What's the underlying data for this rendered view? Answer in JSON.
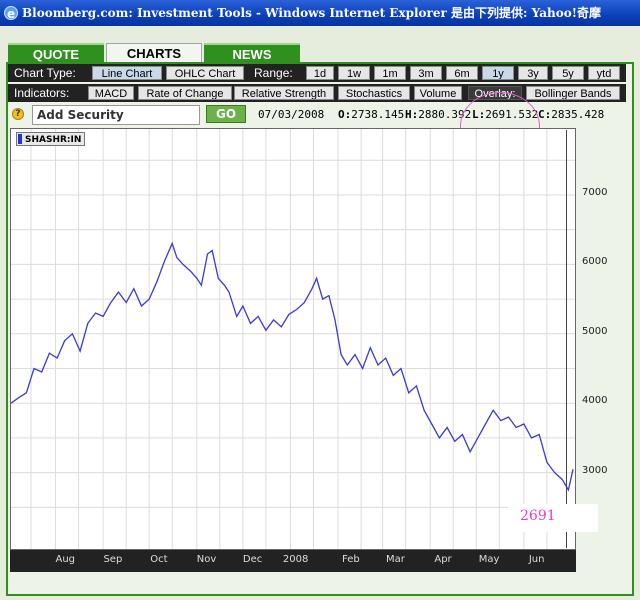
{
  "window": {
    "title": "Bloomberg.com: Investment Tools - Windows Internet Explorer 是由下列提供: Yahoo!奇摩"
  },
  "tabs": [
    {
      "label": "QUOTE"
    },
    {
      "label": "CHARTS"
    },
    {
      "label": "NEWS"
    }
  ],
  "chart_type": {
    "label": "Chart Type:",
    "options": [
      "Line Chart",
      "OHLC Chart"
    ],
    "selected": "Line Chart"
  },
  "range": {
    "label": "Range:",
    "options": [
      "1d",
      "1w",
      "1m",
      "3m",
      "6m",
      "1y",
      "3y",
      "5y",
      "ytd"
    ],
    "selected": "1y"
  },
  "indicators": {
    "label": "Indicators:",
    "options": [
      "MACD",
      "Rate of Change",
      "Relative Strength",
      "Stochastics",
      "Volume"
    ],
    "overlay_label": "Overlay:",
    "overlay_option": "Bollinger Bands"
  },
  "security": {
    "placeholder": "Add Security",
    "go_label": "GO",
    "date": "07/03/2008",
    "open_label": "O:",
    "open": "2738.145",
    "high_label": "H:",
    "high": "2880.392",
    "low_label": "L:",
    "low": "2691.532",
    "close_label": "C:",
    "close": "2835.428"
  },
  "symbol_tag": "SHASHR:IN",
  "annotation": "2691",
  "colors": {
    "line": "#3b3bcc",
    "annotation": "#e040c0",
    "tab_green": "#2f8f1f"
  },
  "chart_data": {
    "type": "line",
    "series_label": "SHASHR:IN",
    "ylim": [
      1900,
      7950
    ],
    "y_ticks": [
      3000,
      4000,
      5000,
      6000,
      7000
    ],
    "x_ticks": [
      "Aug",
      "Sep",
      "Oct",
      "Nov",
      "Dec",
      "2008",
      "Feb",
      "Mar",
      "Apr",
      "May",
      "Jun"
    ],
    "x_range": [
      "2007-07-03",
      "2008-07-03"
    ],
    "points": [
      [
        "2007-07-03",
        4000
      ],
      [
        "2007-07-08",
        4080
      ],
      [
        "2007-07-13",
        4150
      ],
      [
        "2007-07-18",
        4500
      ],
      [
        "2007-07-23",
        4450
      ],
      [
        "2007-07-28",
        4720
      ],
      [
        "2007-08-02",
        4650
      ],
      [
        "2007-08-07",
        4900
      ],
      [
        "2007-08-12",
        5000
      ],
      [
        "2007-08-17",
        4750
      ],
      [
        "2007-08-22",
        5150
      ],
      [
        "2007-08-27",
        5300
      ],
      [
        "2007-09-01",
        5250
      ],
      [
        "2007-09-06",
        5450
      ],
      [
        "2007-09-11",
        5600
      ],
      [
        "2007-09-16",
        5450
      ],
      [
        "2007-09-21",
        5650
      ],
      [
        "2007-09-26",
        5400
      ],
      [
        "2007-10-01",
        5500
      ],
      [
        "2007-10-06",
        5750
      ],
      [
        "2007-10-11",
        6050
      ],
      [
        "2007-10-16",
        6300
      ],
      [
        "2007-10-19",
        6100
      ],
      [
        "2007-10-23",
        6000
      ],
      [
        "2007-10-28",
        5900
      ],
      [
        "2007-11-01",
        5800
      ],
      [
        "2007-11-04",
        5700
      ],
      [
        "2007-11-08",
        6150
      ],
      [
        "2007-11-11",
        6200
      ],
      [
        "2007-11-15",
        5800
      ],
      [
        "2007-11-19",
        5700
      ],
      [
        "2007-11-22",
        5600
      ],
      [
        "2007-11-27",
        5250
      ],
      [
        "2007-12-01",
        5400
      ],
      [
        "2007-12-06",
        5150
      ],
      [
        "2007-12-11",
        5250
      ],
      [
        "2007-12-16",
        5050
      ],
      [
        "2007-12-21",
        5200
      ],
      [
        "2007-12-26",
        5100
      ],
      [
        "2007-12-31",
        5280
      ],
      [
        "2008-01-05",
        5350
      ],
      [
        "2008-01-10",
        5450
      ],
      [
        "2008-01-15",
        5650
      ],
      [
        "2008-01-18",
        5800
      ],
      [
        "2008-01-22",
        5500
      ],
      [
        "2008-01-26",
        5550
      ],
      [
        "2008-01-30",
        5200
      ],
      [
        "2008-02-03",
        4700
      ],
      [
        "2008-02-07",
        4550
      ],
      [
        "2008-02-12",
        4700
      ],
      [
        "2008-02-17",
        4500
      ],
      [
        "2008-02-22",
        4800
      ],
      [
        "2008-02-27",
        4550
      ],
      [
        "2008-03-03",
        4650
      ],
      [
        "2008-03-08",
        4400
      ],
      [
        "2008-03-13",
        4500
      ],
      [
        "2008-03-18",
        4150
      ],
      [
        "2008-03-23",
        4250
      ],
      [
        "2008-03-28",
        3900
      ],
      [
        "2008-04-02",
        3700
      ],
      [
        "2008-04-07",
        3500
      ],
      [
        "2008-04-12",
        3650
      ],
      [
        "2008-04-17",
        3450
      ],
      [
        "2008-04-22",
        3550
      ],
      [
        "2008-04-27",
        3300
      ],
      [
        "2008-05-02",
        3500
      ],
      [
        "2008-05-07",
        3700
      ],
      [
        "2008-05-12",
        3900
      ],
      [
        "2008-05-17",
        3750
      ],
      [
        "2008-05-22",
        3800
      ],
      [
        "2008-05-27",
        3650
      ],
      [
        "2008-06-01",
        3700
      ],
      [
        "2008-06-06",
        3500
      ],
      [
        "2008-06-11",
        3550
      ],
      [
        "2008-06-16",
        3150
      ],
      [
        "2008-06-21",
        3000
      ],
      [
        "2008-06-26",
        2900
      ],
      [
        "2008-06-30",
        2750
      ],
      [
        "2008-07-03",
        3050
      ]
    ]
  }
}
